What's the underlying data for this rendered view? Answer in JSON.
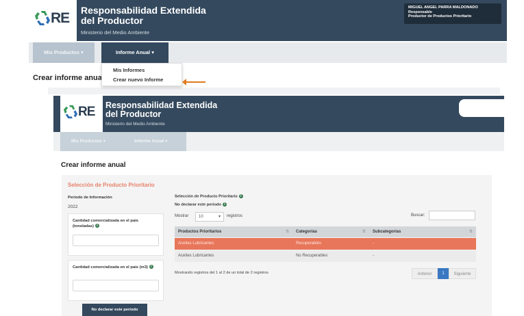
{
  "brand": {
    "logo_text": "RE",
    "logo_subtext": "Ley Rep",
    "title_line1": "Responsabilidad Extendida",
    "title_line2": "del Productor",
    "ministry": "Ministerio del Medio Ambiente"
  },
  "user": {
    "name": "MIGUEL ANGEL PARRA MALDONADO",
    "role": "Responsable",
    "organization": "Productor de Productos Prioritario"
  },
  "nav": {
    "mis_productos": "Mis Productos ▾",
    "informe_anual": "Informe Anual ▾"
  },
  "dropdown": {
    "items": [
      "Mis Informes",
      "Crear nuevo Informe"
    ]
  },
  "page": {
    "title_truncated": "Crear informe anua",
    "title": "Crear informe anual"
  },
  "form": {
    "section_title": "Selección de Producto Prioritario",
    "period_label": "Periodo de Información",
    "period_value": "2022",
    "qty_tons_label": "Cantidad comercializada en el país (toneladas)",
    "qty_m3_label": "Cantidad comercializada en el país (m3)",
    "button_no_declarar": "No declarar este periodo"
  },
  "product_selection": {
    "label": "Selección de Producto Prioritario",
    "no_declarar_label": "No declarar este periodo",
    "show_label": "Mostrar",
    "show_value": "10",
    "records_label": "registros",
    "search_label": "Buscar:"
  },
  "table": {
    "headers": [
      "Productos Prioritarios",
      "Categorías",
      "Subcategorías"
    ],
    "rows": [
      {
        "producto": "Aceites Lubricantes",
        "categoria": "Recuperables",
        "subcategoria": "-"
      },
      {
        "producto": "Aceites Lubricantes",
        "categoria": "No Recuperables",
        "subcategoria": "-"
      }
    ],
    "info": "Mostrando registros del 1 al 2 de un total de 2 registros",
    "pager": {
      "prev": "Anterior",
      "page": "1",
      "next": "Siguiente"
    }
  },
  "colors": {
    "header_bg": "#34495e",
    "accent_orange": "#e8765a",
    "arrow": "#e07b20",
    "pager_active": "#3a78c2"
  }
}
